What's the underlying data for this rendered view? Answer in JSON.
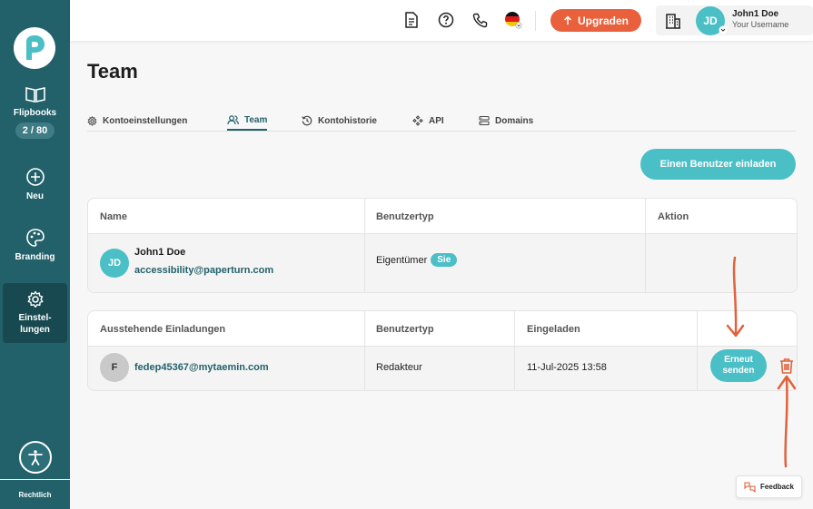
{
  "sidebar": {
    "items": [
      {
        "label": "Flipbooks",
        "badge": "2 / 80",
        "icon": "book-icon"
      },
      {
        "label": "Neu",
        "icon": "plus-circle-icon"
      },
      {
        "label": "Branding",
        "icon": "palette-icon"
      },
      {
        "label": "Einstel-\nlungen",
        "icon": "gear-icon"
      }
    ],
    "footer_label": "Rechtlich"
  },
  "topbar": {
    "upgrade_label": "Upgraden",
    "user": {
      "initials": "JD",
      "name": "John1 Doe",
      "username": "Your Username"
    }
  },
  "page": {
    "title": "Team",
    "tabs": [
      {
        "label": "Kontoeinstellungen",
        "icon": "gear-icon"
      },
      {
        "label": "Team",
        "icon": "users-icon"
      },
      {
        "label": "Kontohistorie",
        "icon": "history-icon"
      },
      {
        "label": "API",
        "icon": "api-icon"
      },
      {
        "label": "Domains",
        "icon": "server-icon"
      }
    ],
    "active_tab": "Team",
    "invite_button": "Einen Benutzer einladen"
  },
  "members_table": {
    "headers": [
      "Name",
      "Benutzertyp",
      "Aktion"
    ],
    "rows": [
      {
        "initials": "JD",
        "name": "John1 Doe",
        "email": "accessibility@paperturn.com",
        "type": "Eigentümer",
        "badge": "Sie"
      }
    ]
  },
  "pending_table": {
    "headers": [
      "Ausstehende Einladungen",
      "Benutzertyp",
      "Eingeladen"
    ],
    "rows": [
      {
        "initial": "F",
        "email": "fedep45367@mytaemin.com",
        "type": "Redakteur",
        "invited": "11-Jul-2025 13:58",
        "resend_label": "Erneut\nsenden"
      }
    ]
  },
  "feedback_label": "Feedback",
  "colors": {
    "sidebar": "#22616a",
    "accent": "#4bbfc6",
    "upgrade": "#e8603c",
    "annotation": "#e0623d"
  }
}
